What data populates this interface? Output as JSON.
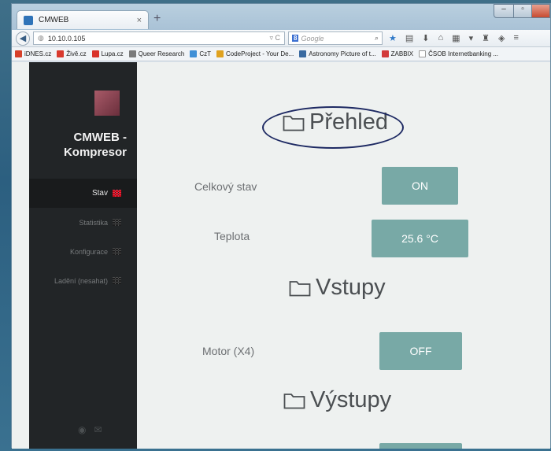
{
  "browser": {
    "tab_title": "CMWEB",
    "tab_close": "×",
    "new_tab": "+",
    "url": "10.10.0.105",
    "search_engine_badge": "8",
    "search_placeholder": "Google",
    "bookmarks": [
      {
        "label": "iDNES.cz",
        "color": "#d6402a"
      },
      {
        "label": "Živě.cz",
        "color": "#d93a2e"
      },
      {
        "label": "Lupa.cz",
        "color": "#d9332a"
      },
      {
        "label": "Queer Research",
        "color": "#7a7a7a"
      },
      {
        "label": "CzT",
        "color": "#3f8fd6"
      },
      {
        "label": "CodeProject - Your De...",
        "color": "#e0a21f"
      },
      {
        "label": "Astronomy Picture of t...",
        "color": "#3a6aa0"
      },
      {
        "label": "ZABBIX",
        "color": "#d23a3a"
      },
      {
        "label": "ČSOB Internetbanking ...",
        "color": "#ffffff"
      }
    ]
  },
  "sidebar": {
    "brand": "CMWEB - Kompresor",
    "items": [
      {
        "label": "Stav",
        "active": true
      },
      {
        "label": "Statistika",
        "active": false
      },
      {
        "label": "Konfigurace",
        "active": false
      },
      {
        "label": "Ladění (nesahat)",
        "active": false
      }
    ]
  },
  "main": {
    "section_overview": "Přehled",
    "section_inputs": "Vstupy",
    "section_outputs": "Výstupy",
    "rows": {
      "total_state_label": "Celkový stav",
      "total_state_value": "ON",
      "temperature_label": "Teplota",
      "temperature_value": "25.6 °C",
      "motor_label": "Motor (X4)",
      "motor_value": "OFF"
    }
  },
  "colors": {
    "accent_button": "#78a9a6",
    "sidebar_bg": "#222527",
    "active_menu_icon": "#e0304a",
    "annotation_ellipse": "#1e2a63"
  }
}
